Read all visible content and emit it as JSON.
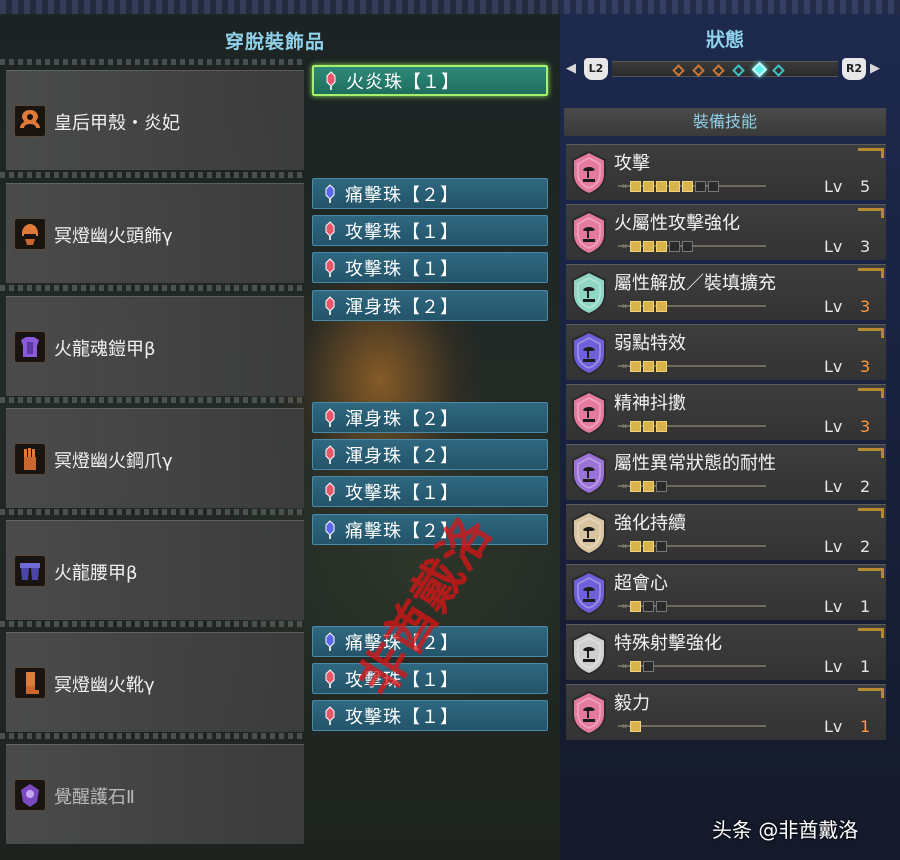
{
  "left_panel": {
    "title": "穿脫裝飾品",
    "equipment": [
      {
        "name": "皇后甲殼・炎妃",
        "icon": "weapon-icon",
        "decorations": [
          {
            "label": "火炎珠【１】",
            "gem": "gem-red-icon",
            "selected": true
          }
        ]
      },
      {
        "name": "冥燈幽火頭飾γ",
        "icon": "helmet-icon",
        "decorations": [
          {
            "label": "痛擊珠【２】",
            "gem": "gem-blue-icon"
          },
          {
            "label": "攻擊珠【１】",
            "gem": "gem-red-icon"
          },
          {
            "label": "攻擊珠【１】",
            "gem": "gem-red-icon"
          }
        ]
      },
      {
        "name": "火龍魂鎧甲β",
        "icon": "chest-icon",
        "decorations": [
          {
            "label": "渾身珠【２】",
            "gem": "gem-red-icon"
          }
        ]
      },
      {
        "name": "冥燈幽火鋼爪γ",
        "icon": "gauntlet-icon",
        "decorations": [
          {
            "label": "渾身珠【２】",
            "gem": "gem-red-icon"
          },
          {
            "label": "渾身珠【２】",
            "gem": "gem-red-icon"
          },
          {
            "label": "攻擊珠【１】",
            "gem": "gem-red-icon"
          }
        ]
      },
      {
        "name": "火龍腰甲β",
        "icon": "waist-icon",
        "decorations": [
          {
            "label": "痛擊珠【２】",
            "gem": "gem-blue-icon"
          }
        ]
      },
      {
        "name": "冥燈幽火靴γ",
        "icon": "boots-icon",
        "decorations": [
          {
            "label": "痛擊珠【２】",
            "gem": "gem-blue-icon"
          },
          {
            "label": "攻擊珠【１】",
            "gem": "gem-red-icon"
          },
          {
            "label": "攻擊珠【１】",
            "gem": "gem-red-icon"
          }
        ]
      },
      {
        "name": "覺醒護石Ⅱ",
        "icon": "charm-icon",
        "decorations": []
      }
    ]
  },
  "right_panel": {
    "title": "狀態",
    "left_button": "L2",
    "right_button": "R2",
    "tab_pages": 6,
    "active_tab": 4,
    "skills_header": "裝備技能",
    "lv_label": "Lv",
    "skills": [
      {
        "name": "攻擊",
        "level": 5,
        "max": 7,
        "color": "#e57aa0",
        "max_reached": false
      },
      {
        "name": "火屬性攻擊強化",
        "level": 3,
        "max": 5,
        "color": "#e57aa0",
        "max_reached": false
      },
      {
        "name": "屬性解放／裝填擴充",
        "level": 3,
        "max": 3,
        "color": "#8fd6c4",
        "max_reached": true
      },
      {
        "name": "弱點特效",
        "level": 3,
        "max": 3,
        "color": "#6f5fd8",
        "max_reached": true
      },
      {
        "name": "精神抖擻",
        "level": 3,
        "max": 3,
        "color": "#e57aa0",
        "max_reached": true
      },
      {
        "name": "屬性異常狀態的耐性",
        "level": 2,
        "max": 3,
        "color": "#9a72d8",
        "max_reached": false
      },
      {
        "name": "強化持續",
        "level": 2,
        "max": 3,
        "color": "#d9c4a0",
        "max_reached": false
      },
      {
        "name": "超會心",
        "level": 1,
        "max": 3,
        "color": "#6f5fd8",
        "max_reached": false
      },
      {
        "name": "特殊射擊強化",
        "level": 1,
        "max": 2,
        "color": "#cfcfcf",
        "max_reached": false
      },
      {
        "name": "毅力",
        "level": 1,
        "max": 1,
        "color": "#e57aa0",
        "max_reached": true
      }
    ]
  },
  "watermark": "非酋戴洛",
  "credit": "头条 @非酋戴洛",
  "colors": {
    "title_blue": "#8fd1ea",
    "deco_blue": "#2f6880",
    "deco_selected": "#2e8a78",
    "pip_on": "#d9b44a",
    "max_level": "#ff9a3a"
  }
}
